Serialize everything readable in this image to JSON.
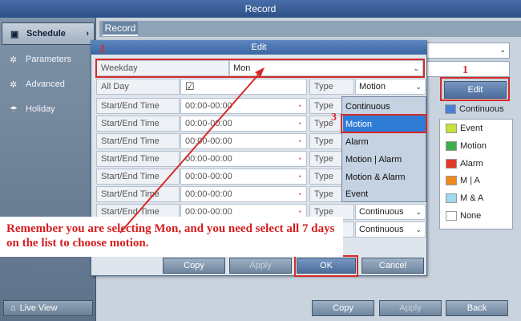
{
  "window": {
    "title": "Record"
  },
  "sidebar": {
    "items": [
      {
        "label": "Schedule",
        "icon": "calendar-icon",
        "glyph": "▣"
      },
      {
        "label": "Parameters",
        "icon": "gear-icon",
        "glyph": "✲"
      },
      {
        "label": "Advanced",
        "icon": "gear-icon",
        "glyph": "✲"
      },
      {
        "label": "Holiday",
        "icon": "umbrella-icon",
        "glyph": "☂"
      }
    ],
    "live_view": "Live View"
  },
  "tabs": [
    {
      "label": "Record"
    }
  ],
  "dialog": {
    "title": "Edit",
    "weekday_label": "Weekday",
    "weekday_value": "Mon",
    "all_day_label": "All Day",
    "all_day_checked": "☑",
    "type_label": "Type",
    "type_value": "Motion",
    "rows": [
      {
        "label": "Start/End Time",
        "time": "00:00-00:00",
        "type_label": "Type",
        "type_value": ""
      },
      {
        "label": "Start/End Time",
        "time": "00:00-00:00",
        "type_label": "Type",
        "type_value": ""
      },
      {
        "label": "Start/End Time",
        "time": "00:00-00:00",
        "type_label": "Type",
        "type_value": ""
      },
      {
        "label": "Start/End Time",
        "time": "00:00-00:00",
        "type_label": "Type",
        "type_value": ""
      },
      {
        "label": "Start/End Time",
        "time": "00:00-00:00",
        "type_label": "Type",
        "type_value": ""
      },
      {
        "label": "Start/End Time",
        "time": "00:00-00:00",
        "type_label": "Type",
        "type_value": ""
      },
      {
        "label": "Start/End Time",
        "time": "00:00-00:00",
        "type_label": "Type",
        "type_value": "Continuous"
      },
      {
        "label": "Start/End Time",
        "time": "00:00-00:00",
        "type_label": "Type",
        "type_value": "Continuous"
      }
    ],
    "dropdown": [
      "Continuous",
      "Motion",
      "Alarm",
      "Motion | Alarm",
      "Motion & Alarm",
      "Event"
    ],
    "buttons": {
      "copy": "Copy",
      "apply": "Apply",
      "ok": "OK",
      "cancel": "Cancel"
    }
  },
  "right_panel": {
    "edit_button": "Edit",
    "legend": [
      {
        "label": "Continuous",
        "color": "#4a7fd6"
      },
      {
        "label": "Event",
        "color": "#c6e23a"
      },
      {
        "label": "Motion",
        "color": "#3fae47"
      },
      {
        "label": "Alarm",
        "color": "#e03a2b"
      },
      {
        "label": "M | A",
        "color": "#f08a1c"
      },
      {
        "label": "M & A",
        "color": "#9fd8f0"
      },
      {
        "label": "None",
        "color": "#ffffff"
      }
    ]
  },
  "bottom_buttons": {
    "copy": "Copy",
    "apply": "Apply",
    "back": "Back"
  },
  "annotations": {
    "num1": "1",
    "num2": "2",
    "num3": "3",
    "note": "Remember you are selecting Mon, and you need select all 7 days on the list to choose motion."
  }
}
